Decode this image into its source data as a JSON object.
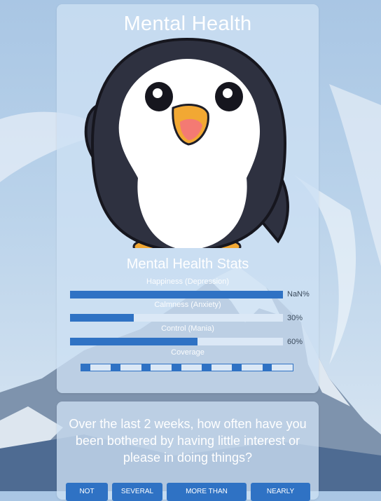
{
  "app": {
    "title": "Mental Health"
  },
  "stats": {
    "title": "Mental Health Stats",
    "items": [
      {
        "label": "Happiness (Depression)",
        "value_text": "NaN%",
        "fill_fraction": 1.0
      },
      {
        "label": "Calmness (Anxiety)",
        "value_text": "30%",
        "fill_fraction": 0.3
      },
      {
        "label": "Control (Mania)",
        "value_text": "60%",
        "fill_fraction": 0.6
      }
    ],
    "coverage": {
      "label": "Coverage",
      "segments": 7,
      "filled_each": 0.3
    }
  },
  "question": {
    "text": "Over the last 2 weeks, how often have you been bothered by having little interest or please in doing things?",
    "answers": [
      "NOT",
      "SEVERAL",
      "MORE THAN",
      "NEARLY"
    ]
  },
  "colors": {
    "accent": "#2f72c4",
    "track": "#dbe8f6"
  },
  "mascot": {
    "icon": "penguin-illustration"
  }
}
